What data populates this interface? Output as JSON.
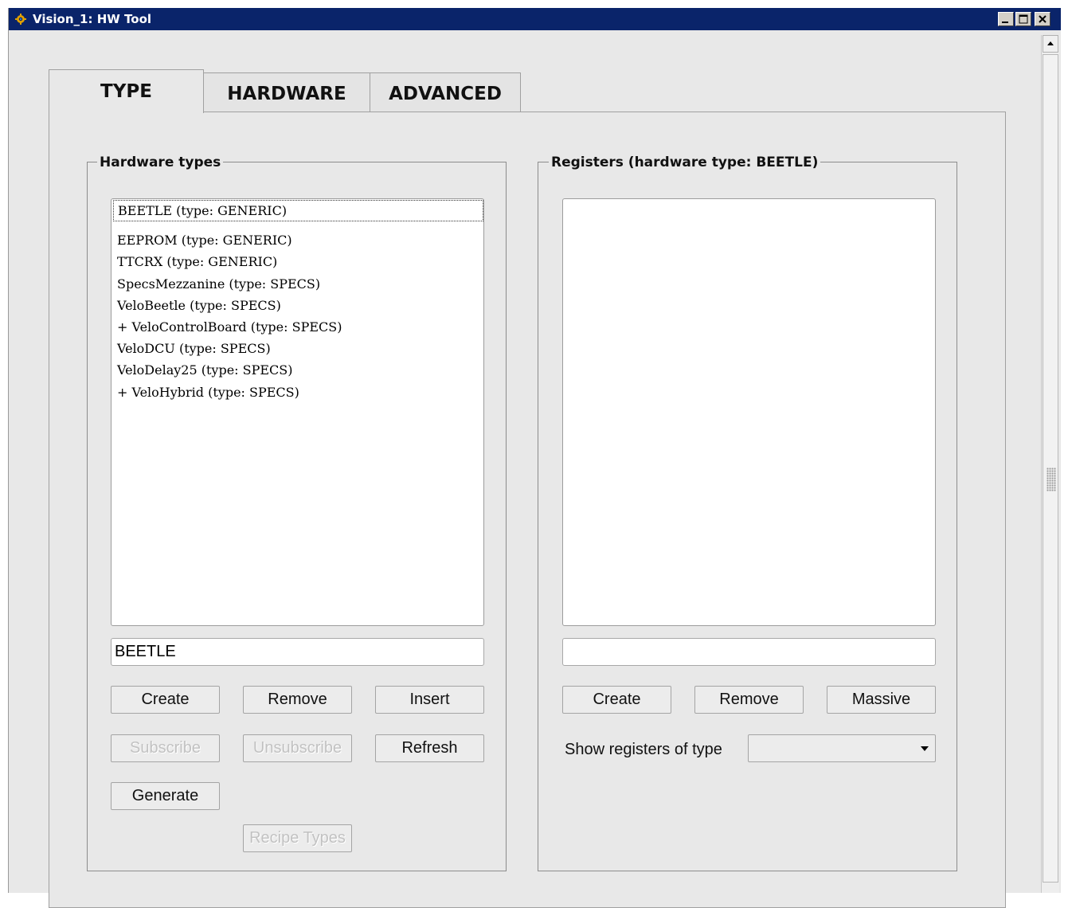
{
  "window": {
    "title": "Vision_1: HW Tool",
    "icon": "gear-icon",
    "controls": [
      "minimize-icon",
      "maximize-icon",
      "close-icon"
    ]
  },
  "tabs": [
    {
      "label": "TYPE",
      "active": true
    },
    {
      "label": "HARDWARE",
      "active": false
    },
    {
      "label": "ADVANCED",
      "active": false
    }
  ],
  "hardware_types": {
    "group_title": "Hardware types",
    "items": [
      "BEETLE (type: GENERIC)",
      "EEPROM (type: GENERIC)",
      "TTCRX (type: GENERIC)",
      "SpecsMezzanine (type: SPECS)",
      "VeloBeetle (type: SPECS)",
      "+ VeloControlBoard (type: SPECS)",
      "VeloDCU (type: SPECS)",
      "VeloDelay25 (type: SPECS)",
      "+ VeloHybrid (type: SPECS)"
    ],
    "selected_index": 0,
    "name_field_value": "BEETLE",
    "buttons": {
      "create": "Create",
      "remove": "Remove",
      "insert": "Insert",
      "subscribe": "Subscribe",
      "unsubscribe": "Unsubscribe",
      "refresh": "Refresh",
      "generate": "Generate",
      "recipe_types": "Recipe Types"
    }
  },
  "registers": {
    "group_title": "Registers (hardware type: BEETLE)",
    "items": [],
    "name_field_value": "",
    "buttons": {
      "create": "Create",
      "remove": "Remove",
      "massive": "Massive"
    },
    "show_type_label": "Show registers of type",
    "show_type_value": ""
  },
  "colors": {
    "titlebar": "#0a246a",
    "background": "#e8e8e8"
  }
}
